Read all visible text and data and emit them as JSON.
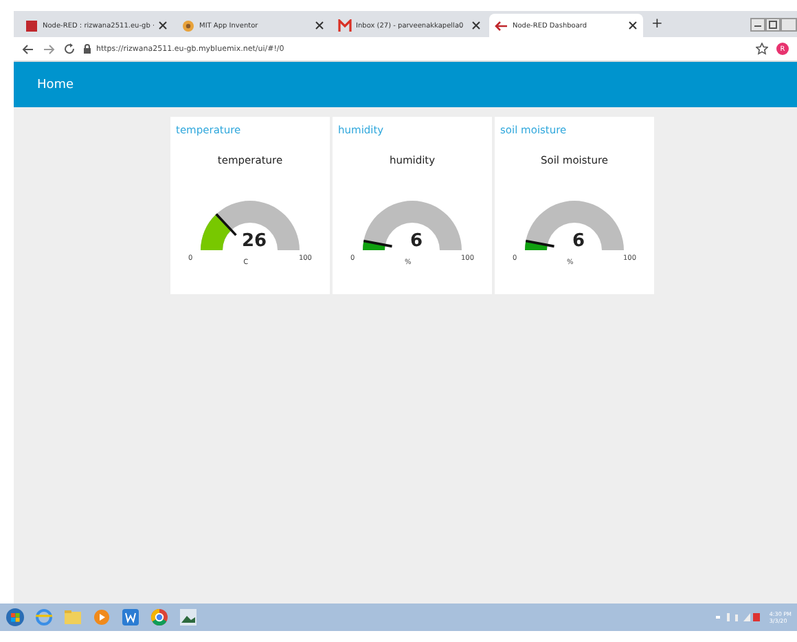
{
  "browser": {
    "tabs": [
      {
        "title": "Node-RED : rizwana2511.eu-gb ·",
        "selected": false
      },
      {
        "title": "MIT App Inventor",
        "selected": false
      },
      {
        "title": "Inbox (27) - parveenakkapella0",
        "selected": false
      },
      {
        "title": "Node-RED Dashboard",
        "selected": true
      }
    ],
    "new_tab": "+",
    "address": "https://rizwana2511.eu-gb.mybluemix.net/ui/#!/0",
    "profile": "R"
  },
  "header": {
    "title": "Home"
  },
  "groups": [
    {
      "title": "temperature",
      "gauge": {
        "label": "temperature",
        "value": "26",
        "unit": "C",
        "min": "0",
        "max": "100",
        "color": "#78c800"
      }
    },
    {
      "title": "humidity",
      "gauge": {
        "label": "humidity",
        "value": "6",
        "unit": "%",
        "min": "0",
        "max": "100",
        "color": "#10a010"
      }
    },
    {
      "title": "soil moisture",
      "gauge": {
        "label": "Soil moisture",
        "value": "6",
        "unit": "%",
        "min": "0",
        "max": "100",
        "color": "#10a010"
      }
    }
  ],
  "taskbar": {
    "time": "4:30 PM",
    "date": "3/3/20"
  }
}
